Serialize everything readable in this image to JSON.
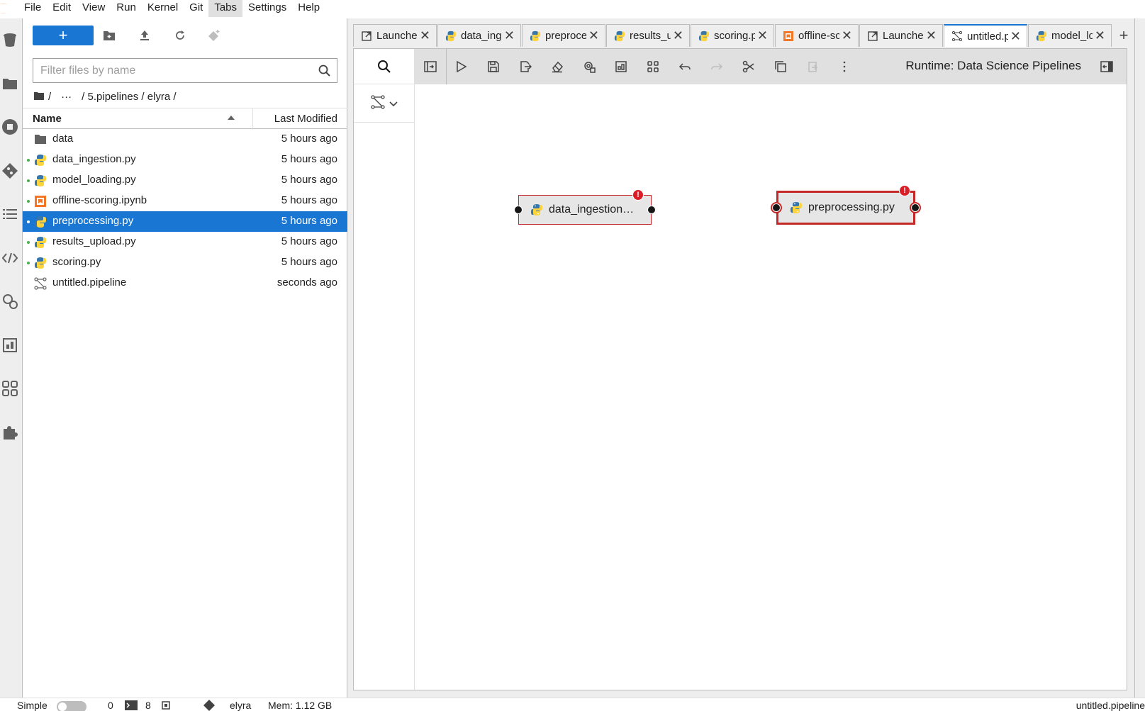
{
  "menubar": {
    "items": [
      "File",
      "Edit",
      "View",
      "Run",
      "Kernel",
      "Git",
      "Tabs",
      "Settings",
      "Help"
    ],
    "active": "Tabs"
  },
  "filebrowser": {
    "new_button": "+",
    "filter_placeholder": "Filter files by name",
    "breadcrumb": {
      "root": "/",
      "ellipsis": "···",
      "path": "/ 5.pipelines / elyra /"
    },
    "columns": {
      "name": "Name",
      "modified": "Last Modified"
    },
    "files": [
      {
        "name": "data",
        "modified": "5 hours ago",
        "type": "folder",
        "running": false
      },
      {
        "name": "data_ingestion.py",
        "modified": "5 hours ago",
        "type": "python",
        "running": true
      },
      {
        "name": "model_loading.py",
        "modified": "5 hours ago",
        "type": "python",
        "running": true
      },
      {
        "name": "offline-scoring.ipynb",
        "modified": "5 hours ago",
        "type": "notebook",
        "running": true
      },
      {
        "name": "preprocessing.py",
        "modified": "5 hours ago",
        "type": "python",
        "running": true,
        "selected": true
      },
      {
        "name": "results_upload.py",
        "modified": "5 hours ago",
        "type": "python",
        "running": true
      },
      {
        "name": "scoring.py",
        "modified": "5 hours ago",
        "type": "python",
        "running": true
      },
      {
        "name": "untitled.pipeline",
        "modified": "seconds ago",
        "type": "pipeline",
        "running": false
      }
    ]
  },
  "tabs": [
    {
      "label": "Launcher",
      "icon": "launcher-icon",
      "active": false
    },
    {
      "label": "data_ingestion.py",
      "icon": "python-icon",
      "active": false
    },
    {
      "label": "preprocessing.py",
      "icon": "python-icon",
      "active": false
    },
    {
      "label": "results_upload.py",
      "icon": "python-icon",
      "active": false
    },
    {
      "label": "scoring.py",
      "icon": "python-icon",
      "active": false
    },
    {
      "label": "offline-scoring.ipynb",
      "icon": "notebook-icon",
      "active": false
    },
    {
      "label": "Launcher",
      "icon": "launcher-icon",
      "active": false
    },
    {
      "label": "untitled.pipeline",
      "icon": "pipeline-icon",
      "active": true
    },
    {
      "label": "model_loading.py",
      "icon": "python-icon",
      "active": false
    }
  ],
  "pipeline_editor": {
    "runtime_label": "Runtime: Data Science Pipelines",
    "nodes": [
      {
        "label": "data_ingestion…",
        "has_error": true,
        "error_symbol": "!",
        "selected": false
      },
      {
        "label": "preprocessing.py",
        "has_error": true,
        "error_symbol": "!",
        "selected": true
      }
    ]
  },
  "statusbar": {
    "simple_label": "Simple",
    "kernels_count": "0",
    "terminals_count": "8",
    "git_branch": "elyra",
    "memory": "Mem: 1.12 GB",
    "current_file": "untitled.pipeline"
  },
  "colors": {
    "accent": "#1976d2",
    "error": "#da1e28",
    "selected_node_border": "#c62828",
    "running_dot": "#4caf50"
  }
}
